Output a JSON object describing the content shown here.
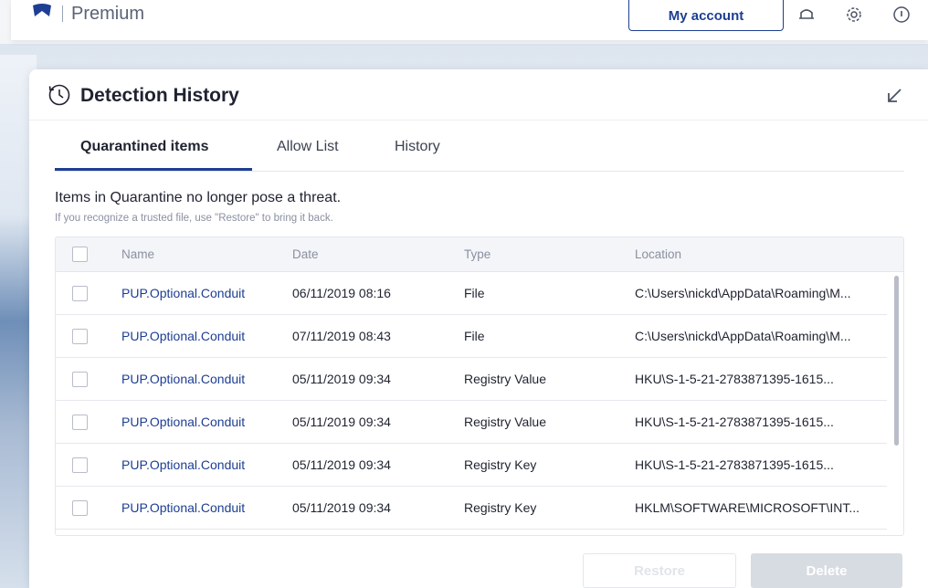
{
  "topbar": {
    "product": "Premium",
    "account_button": "My account",
    "icons": [
      "logo-icon",
      "bell-icon",
      "gear-icon",
      "help-icon"
    ]
  },
  "dialog": {
    "title": "Detection History",
    "tabs": [
      {
        "label": "Quarantined items",
        "active": true
      },
      {
        "label": "Allow List",
        "active": false
      },
      {
        "label": "History",
        "active": false
      }
    ],
    "info_main": "Items in Quarantine no longer pose a threat.",
    "info_sub": "If you recognize a trusted file, use \"Restore\" to bring it back.",
    "table": {
      "columns": [
        "Name",
        "Date",
        "Type",
        "Location"
      ],
      "rows": [
        {
          "name": "PUP.Optional.Conduit",
          "date": "06/11/2019 08:16",
          "type": "File",
          "location": "C:\\Users\\nickd\\AppData\\Roaming\\M..."
        },
        {
          "name": "PUP.Optional.Conduit",
          "date": "07/11/2019 08:43",
          "type": "File",
          "location": "C:\\Users\\nickd\\AppData\\Roaming\\M..."
        },
        {
          "name": "PUP.Optional.Conduit",
          "date": "05/11/2019 09:34",
          "type": "Registry Value",
          "location": "HKU\\S-1-5-21-2783871395-1615..."
        },
        {
          "name": "PUP.Optional.Conduit",
          "date": "05/11/2019 09:34",
          "type": "Registry Value",
          "location": "HKU\\S-1-5-21-2783871395-1615..."
        },
        {
          "name": "PUP.Optional.Conduit",
          "date": "05/11/2019 09:34",
          "type": "Registry Key",
          "location": "HKU\\S-1-5-21-2783871395-1615..."
        },
        {
          "name": "PUP.Optional.Conduit",
          "date": "05/11/2019 09:34",
          "type": "Registry Key",
          "location": "HKLM\\SOFTWARE\\MICROSOFT\\INT..."
        }
      ]
    },
    "buttons": {
      "restore": "Restore",
      "delete": "Delete"
    }
  },
  "colors": {
    "accent": "#1d3e93",
    "link": "#1d3e93",
    "disabled": "#d7dbe2"
  }
}
